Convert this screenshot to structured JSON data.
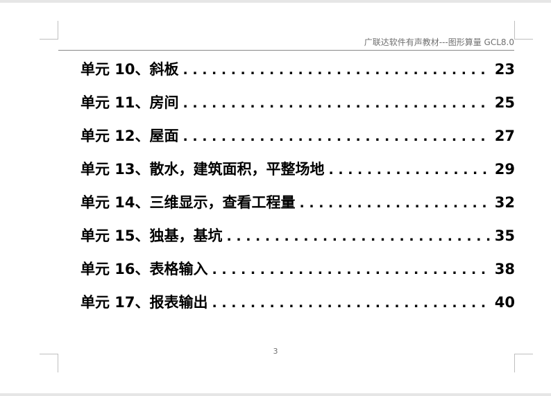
{
  "header": {
    "text": "广联达软件有声教材---图形算量 GCL8.0"
  },
  "toc": {
    "entries": [
      {
        "title": "单元 10、斜板",
        "page": "23"
      },
      {
        "title": "单元 11、房间",
        "page": "25"
      },
      {
        "title": "单元 12、屋面",
        "page": "27"
      },
      {
        "title": "单元 13、散水，建筑面积，平整场地",
        "page": "29"
      },
      {
        "title": "单元 14、三维显示，查看工程量",
        "page": "32"
      },
      {
        "title": "单元 15、独基，基坑",
        "page": "35"
      },
      {
        "title": "单元 16、表格输入",
        "page": "38"
      },
      {
        "title": "单元 17、报表输出",
        "page": "40"
      }
    ]
  },
  "footer": {
    "page_number": "3"
  }
}
